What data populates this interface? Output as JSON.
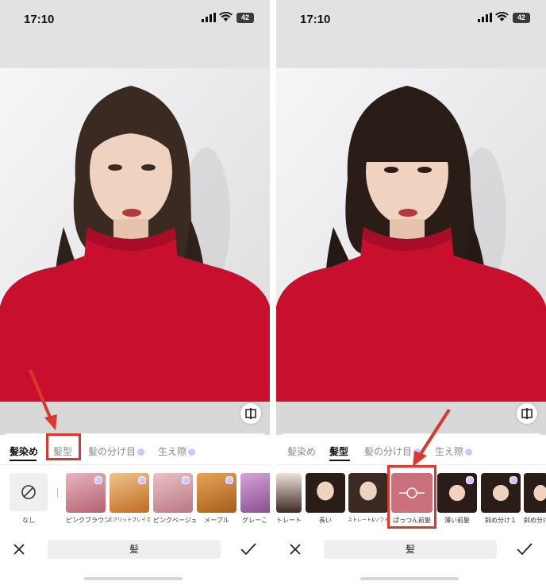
{
  "status": {
    "time": "17:10",
    "battery": "42"
  },
  "left": {
    "tabs": [
      {
        "label": "髪染め",
        "active": true,
        "premium": false
      },
      {
        "label": "髪型",
        "active": false,
        "premium": false
      },
      {
        "label": "髪の分け目",
        "active": false,
        "premium": true
      },
      {
        "label": "生え際",
        "active": false,
        "premium": true
      }
    ],
    "none_label": "なし",
    "swatches": [
      {
        "label": "ピンクブラウン",
        "color": "#c97a86"
      },
      {
        "label": "エアリットブレイズ",
        "color": "#d9883e"
      },
      {
        "label": "ピンクベージュ",
        "color": "#c9909a"
      },
      {
        "label": "メープル",
        "color": "#c67c2a"
      },
      {
        "label": "グレーこ",
        "color": "#b07ab8"
      }
    ],
    "toolbar_label": "髪"
  },
  "right": {
    "tabs": [
      {
        "label": "髪染め",
        "active": false,
        "premium": false
      },
      {
        "label": "髪型",
        "active": true,
        "premium": false
      },
      {
        "label": "髪の分け目",
        "active": false,
        "premium": true
      },
      {
        "label": "生え際",
        "active": false,
        "premium": true
      }
    ],
    "styles": [
      {
        "label": "トレート"
      },
      {
        "label": "長い"
      },
      {
        "label": "ストレート&ソフト"
      },
      {
        "label": "ぱっつん前髪",
        "selected": true
      },
      {
        "label": "薄い前髪"
      },
      {
        "label": "斜め分け１"
      },
      {
        "label": "斜め分け"
      }
    ],
    "toolbar_label": "髪"
  },
  "colors": {
    "annotation_red": "#d9382e",
    "sweater_red": "#c8102e"
  },
  "icons": [
    "signal-icon",
    "wifi-icon",
    "battery-icon",
    "compare-icon",
    "no-color-icon",
    "close-icon",
    "check-icon",
    "adjust-icon"
  ]
}
